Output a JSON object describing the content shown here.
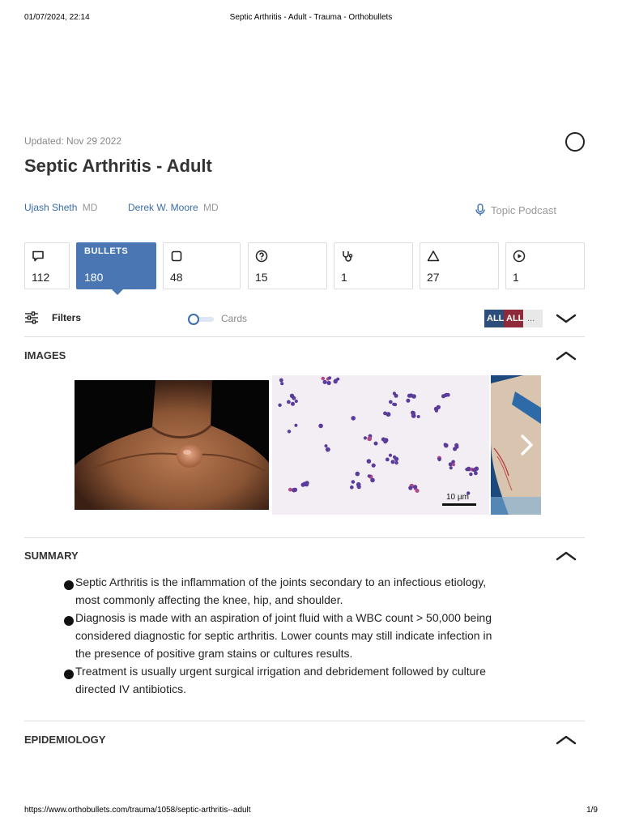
{
  "print_header": {
    "date": "01/07/2024, 22:14",
    "title": "Septic Arthritis - Adult - Trauma - Orthobullets"
  },
  "print_footer": {
    "url": "https://www.orthobullets.com/trauma/1058/septic-arthritis--adult",
    "page": "1/9"
  },
  "topic": {
    "updated": "Updated: Nov 29 2022",
    "title": "Septic Arthritis - Adult"
  },
  "authors": [
    {
      "name": "Ujash Sheth",
      "credential": "MD"
    },
    {
      "name": "Derek W. Moore",
      "credential": "MD"
    }
  ],
  "podcast": {
    "label": "Topic Podcast",
    "icon": "microphone-icon"
  },
  "stats": [
    {
      "icon": "comment-icon",
      "count": "112"
    },
    {
      "label": "BULLETS",
      "count": "180",
      "active": true
    },
    {
      "icon": "card-icon",
      "count": "48"
    },
    {
      "icon": "question-icon",
      "count": "15"
    },
    {
      "icon": "stethoscope-icon",
      "count": "1"
    },
    {
      "icon": "warning-triangle-icon",
      "count": "27"
    },
    {
      "icon": "play-icon",
      "count": "1"
    }
  ],
  "filters": {
    "label": "Filters",
    "cards_label": "Cards",
    "tags": [
      "ALL",
      "ALL",
      "..."
    ],
    "tag_colors": [
      "#2d4e7a",
      "#8e2a3a",
      "#e8e8e8"
    ],
    "accent": "#4a77b4"
  },
  "sections": {
    "images": "IMAGES",
    "summary": "SUMMARY",
    "epidemiology": "EPIDEMIOLOGY"
  },
  "images": {
    "scale_label": "10 µm"
  },
  "summary": [
    "Septic Arthritis is the inflammation of the joints secondary to an infectious etiology, most commonly affecting the knee, hip, and shoulder.",
    "Diagnosis is made with an aspiration of joint fluid with a WBC count > 50,000 being considered diagnostic for septic arthritis. Lower counts may still indicate infection in the presence of positive gram stains or cultures results.",
    "Treatment is usually urgent surgical irrigation and debridement followed by culture directed IV antibiotics."
  ]
}
